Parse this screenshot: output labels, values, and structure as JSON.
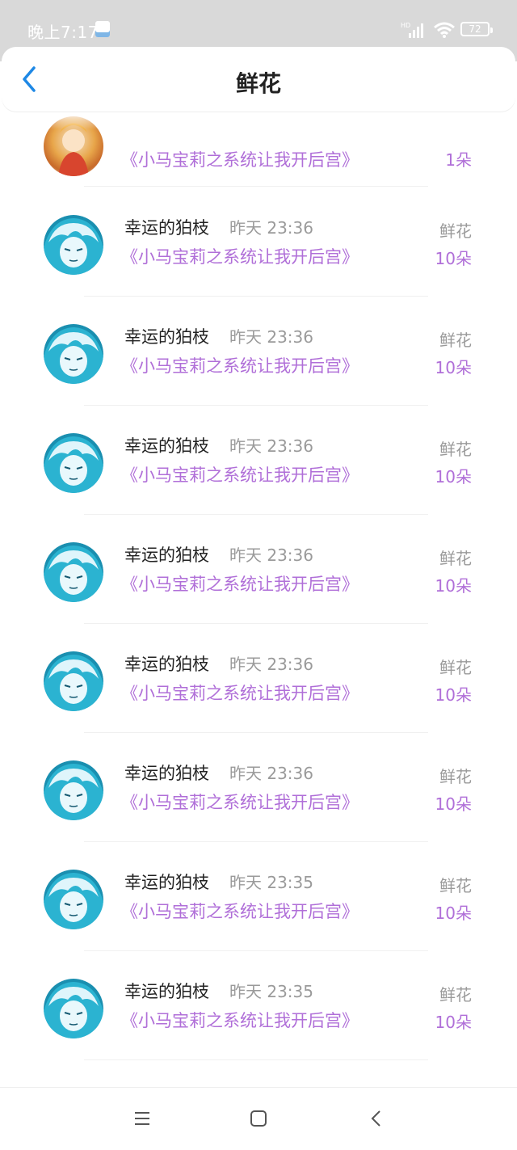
{
  "status_bar": {
    "time": "晚上7:17",
    "battery": "72",
    "icons": [
      "app-notification-icon",
      "hd-signal-icon",
      "wifi-icon",
      "battery-icon"
    ]
  },
  "header": {
    "title": "鲜花",
    "back_icon": "chevron-left-icon"
  },
  "list": {
    "items": [
      {
        "name": "幸运的狛枝",
        "time": "昨天 23:36",
        "book": "《小马宝莉之系统让我开后宫》",
        "gift_type": "鲜花",
        "gift_count": "10朵"
      },
      {
        "name": "幸运的狛枝",
        "time": "昨天 23:36",
        "book": "《小马宝莉之系统让我开后宫》",
        "gift_type": "鲜花",
        "gift_count": "10朵"
      },
      {
        "name": "幸运的狛枝",
        "time": "昨天 23:36",
        "book": "《小马宝莉之系统让我开后宫》",
        "gift_type": "鲜花",
        "gift_count": "10朵"
      },
      {
        "name": "幸运的狛枝",
        "time": "昨天 23:36",
        "book": "《小马宝莉之系统让我开后宫》",
        "gift_type": "鲜花",
        "gift_count": "10朵"
      },
      {
        "name": "幸运的狛枝",
        "time": "昨天 23:36",
        "book": "《小马宝莉之系统让我开后宫》",
        "gift_type": "鲜花",
        "gift_count": "10朵"
      },
      {
        "name": "幸运的狛枝",
        "time": "昨天 23:36",
        "book": "《小马宝莉之系统让我开后宫》",
        "gift_type": "鲜花",
        "gift_count": "10朵"
      },
      {
        "name": "幸运的狛枝",
        "time": "昨天 23:35",
        "book": "《小马宝莉之系统让我开后宫》",
        "gift_type": "鲜花",
        "gift_count": "10朵"
      },
      {
        "name": "幸运的狛枝",
        "time": "昨天 23:35",
        "book": "《小马宝莉之系统让我开后宫》",
        "gift_type": "鲜花",
        "gift_count": "10朵"
      }
    ],
    "partial_first_item": {
      "book": "《小马宝莉之系统让我开后宫》",
      "gift_count": "1朵"
    }
  },
  "nav_bar": {
    "icons": [
      "menu-icon",
      "home-icon",
      "back-icon"
    ]
  },
  "colors": {
    "accent_purple": "#b06fd8",
    "back_blue": "#1e88e5",
    "status_bar_bg": "#d9d9d9"
  }
}
